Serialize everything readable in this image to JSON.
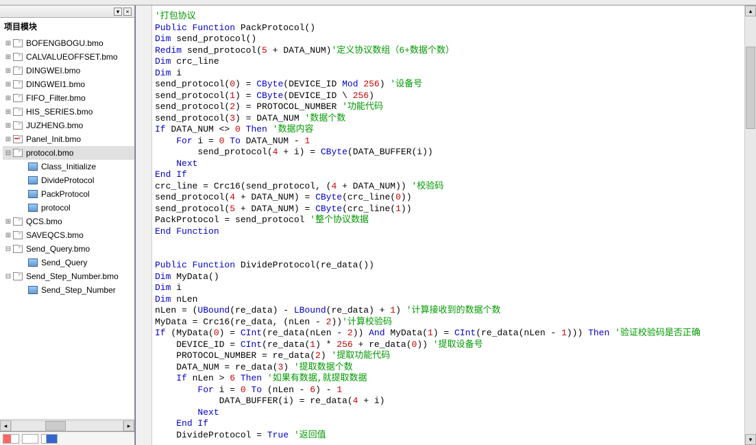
{
  "panel": {
    "title": "项目模块"
  },
  "tree": {
    "items": [
      {
        "icon": "doc",
        "label": "BOFENGBOGU.bmo",
        "exp": "⊞"
      },
      {
        "icon": "doc",
        "label": "CALVALUEOFFSET.bmo",
        "exp": "⊞"
      },
      {
        "icon": "doc",
        "label": "DINGWEI.bmo",
        "exp": "⊞"
      },
      {
        "icon": "doc",
        "label": "DINGWEI1.bmo",
        "exp": "⊞"
      },
      {
        "icon": "doc",
        "label": "FIFO_Filter.bmo",
        "exp": "⊞"
      },
      {
        "icon": "doc",
        "label": "HIS_SERIES.bmo",
        "exp": "⊞"
      },
      {
        "icon": "doc",
        "label": "JUZHENG.bmo",
        "exp": "⊞"
      },
      {
        "icon": "doc-red",
        "label": "Panel_Init.bmo",
        "exp": "⊞"
      },
      {
        "icon": "doc",
        "label": "protocol.bmo",
        "exp": "⊟",
        "selected": true
      },
      {
        "icon": "mod",
        "label": "Class_Initialize",
        "indent": 1,
        "exp": ""
      },
      {
        "icon": "mod",
        "label": "DivideProtocol",
        "indent": 1,
        "exp": ""
      },
      {
        "icon": "mod",
        "label": "PackProtocol",
        "indent": 1,
        "exp": ""
      },
      {
        "icon": "mod",
        "label": "protocol",
        "indent": 1,
        "exp": ""
      },
      {
        "icon": "doc",
        "label": "QCS.bmo",
        "exp": "⊞"
      },
      {
        "icon": "doc",
        "label": "SAVEQCS.bmo",
        "exp": "⊞"
      },
      {
        "icon": "doc",
        "label": "Send_Query.bmo",
        "exp": "⊟"
      },
      {
        "icon": "mod",
        "label": "Send_Query",
        "indent": 1,
        "exp": ""
      },
      {
        "icon": "doc",
        "label": "Send_Step_Number.bmo",
        "exp": "⊟"
      },
      {
        "icon": "mod",
        "label": "Send_Step_Number",
        "indent": 1,
        "exp": ""
      }
    ]
  },
  "code": {
    "lines": [
      [
        {
          "t": "'打包协议",
          "c": "cm"
        }
      ],
      [
        {
          "t": "Public Function",
          "c": "kw"
        },
        {
          "t": " PackProtocol()"
        }
      ],
      [
        {
          "t": "Dim",
          "c": "kw"
        },
        {
          "t": " send_protocol()"
        }
      ],
      [
        {
          "t": "Redim",
          "c": "kw"
        },
        {
          "t": " send_protocol("
        },
        {
          "t": "5",
          "c": "nm"
        },
        {
          "t": " + DATA_NUM)"
        },
        {
          "t": "'定义协议数组（6+数据个数）",
          "c": "cm"
        }
      ],
      [
        {
          "t": "Dim",
          "c": "kw"
        },
        {
          "t": " crc_line"
        }
      ],
      [
        {
          "t": "Dim",
          "c": "kw"
        },
        {
          "t": " i"
        }
      ],
      [
        {
          "t": "send_protocol("
        },
        {
          "t": "0",
          "c": "nm"
        },
        {
          "t": ") = "
        },
        {
          "t": "CByte",
          "c": "kw"
        },
        {
          "t": "(DEVICE_ID "
        },
        {
          "t": "Mod",
          "c": "kw"
        },
        {
          "t": " "
        },
        {
          "t": "256",
          "c": "nm"
        },
        {
          "t": ") "
        },
        {
          "t": "'设备号",
          "c": "cm"
        }
      ],
      [
        {
          "t": "send_protocol("
        },
        {
          "t": "1",
          "c": "nm"
        },
        {
          "t": ") = "
        },
        {
          "t": "CByte",
          "c": "kw"
        },
        {
          "t": "(DEVICE_ID \\ "
        },
        {
          "t": "256",
          "c": "nm"
        },
        {
          "t": ")"
        }
      ],
      [
        {
          "t": "send_protocol("
        },
        {
          "t": "2",
          "c": "nm"
        },
        {
          "t": ") = PROTOCOL_NUMBER "
        },
        {
          "t": "'功能代码",
          "c": "cm"
        }
      ],
      [
        {
          "t": "send_protocol("
        },
        {
          "t": "3",
          "c": "nm"
        },
        {
          "t": ") = DATA_NUM "
        },
        {
          "t": "'数据个数",
          "c": "cm"
        }
      ],
      [
        {
          "t": "If",
          "c": "kw"
        },
        {
          "t": " DATA_NUM <> "
        },
        {
          "t": "0",
          "c": "nm"
        },
        {
          "t": " "
        },
        {
          "t": "Then",
          "c": "kw"
        },
        {
          "t": " "
        },
        {
          "t": "'数据内容",
          "c": "cm"
        }
      ],
      [
        {
          "t": "    "
        },
        {
          "t": "For",
          "c": "kw"
        },
        {
          "t": " i = "
        },
        {
          "t": "0",
          "c": "nm"
        },
        {
          "t": " "
        },
        {
          "t": "To",
          "c": "kw"
        },
        {
          "t": " DATA_NUM - "
        },
        {
          "t": "1",
          "c": "nm"
        }
      ],
      [
        {
          "t": "        send_protocol("
        },
        {
          "t": "4",
          "c": "nm"
        },
        {
          "t": " + i) = "
        },
        {
          "t": "CByte",
          "c": "kw"
        },
        {
          "t": "(DATA_BUFFER(i))"
        }
      ],
      [
        {
          "t": "    "
        },
        {
          "t": "Next",
          "c": "kw"
        }
      ],
      [
        {
          "t": "End If",
          "c": "kw"
        }
      ],
      [
        {
          "t": "crc_line = Crc16(send_protocol, ("
        },
        {
          "t": "4",
          "c": "nm"
        },
        {
          "t": " + DATA_NUM)) "
        },
        {
          "t": "'校验码",
          "c": "cm"
        }
      ],
      [
        {
          "t": "send_protocol("
        },
        {
          "t": "4",
          "c": "nm"
        },
        {
          "t": " + DATA_NUM) = "
        },
        {
          "t": "CByte",
          "c": "kw"
        },
        {
          "t": "(crc_line("
        },
        {
          "t": "0",
          "c": "nm"
        },
        {
          "t": "))"
        }
      ],
      [
        {
          "t": "send_protocol("
        },
        {
          "t": "5",
          "c": "nm"
        },
        {
          "t": " + DATA_NUM) = "
        },
        {
          "t": "CByte",
          "c": "kw"
        },
        {
          "t": "(crc_line("
        },
        {
          "t": "1",
          "c": "nm"
        },
        {
          "t": "))"
        }
      ],
      [
        {
          "t": "PackProtocol = send_protocol "
        },
        {
          "t": "'整个协议数据",
          "c": "cm"
        }
      ],
      [
        {
          "t": "End Function",
          "c": "kw"
        }
      ],
      [
        {
          "t": ""
        }
      ],
      [
        {
          "t": ""
        }
      ],
      [
        {
          "t": "Public Function",
          "c": "kw"
        },
        {
          "t": " DivideProtocol(re_data())"
        }
      ],
      [
        {
          "t": "Dim",
          "c": "kw"
        },
        {
          "t": " MyData()"
        }
      ],
      [
        {
          "t": "Dim",
          "c": "kw"
        },
        {
          "t": " i"
        }
      ],
      [
        {
          "t": "Dim",
          "c": "kw"
        },
        {
          "t": " nLen"
        }
      ],
      [
        {
          "t": "nLen = ("
        },
        {
          "t": "UBound",
          "c": "kw"
        },
        {
          "t": "(re_data) - "
        },
        {
          "t": "LBound",
          "c": "kw"
        },
        {
          "t": "(re_data) + "
        },
        {
          "t": "1",
          "c": "nm"
        },
        {
          "t": ") "
        },
        {
          "t": "'计算接收到的数据个数",
          "c": "cm"
        }
      ],
      [
        {
          "t": "MyData = Crc16(re_data, (nLen - "
        },
        {
          "t": "2",
          "c": "nm"
        },
        {
          "t": "))"
        },
        {
          "t": "'计算校验码",
          "c": "cm"
        }
      ],
      [
        {
          "t": "If",
          "c": "kw"
        },
        {
          "t": " (MyData("
        },
        {
          "t": "0",
          "c": "nm"
        },
        {
          "t": ") = "
        },
        {
          "t": "CInt",
          "c": "kw"
        },
        {
          "t": "(re_data(nLen - "
        },
        {
          "t": "2",
          "c": "nm"
        },
        {
          "t": ")) "
        },
        {
          "t": "And",
          "c": "kw"
        },
        {
          "t": " MyData("
        },
        {
          "t": "1",
          "c": "nm"
        },
        {
          "t": ") = "
        },
        {
          "t": "CInt",
          "c": "kw"
        },
        {
          "t": "(re_data(nLen - "
        },
        {
          "t": "1",
          "c": "nm"
        },
        {
          "t": "))) "
        },
        {
          "t": "Then",
          "c": "kw"
        },
        {
          "t": " "
        },
        {
          "t": "'验证校验码是否正确",
          "c": "cm"
        }
      ],
      [
        {
          "t": "    DEVICE_ID = "
        },
        {
          "t": "CInt",
          "c": "kw"
        },
        {
          "t": "(re_data("
        },
        {
          "t": "1",
          "c": "nm"
        },
        {
          "t": ") * "
        },
        {
          "t": "256",
          "c": "nm"
        },
        {
          "t": " + re_data("
        },
        {
          "t": "0",
          "c": "nm"
        },
        {
          "t": ")) "
        },
        {
          "t": "'提取设备号",
          "c": "cm"
        }
      ],
      [
        {
          "t": "    PROTOCOL_NUMBER = re_data("
        },
        {
          "t": "2",
          "c": "nm"
        },
        {
          "t": ") "
        },
        {
          "t": "'提取功能代码",
          "c": "cm"
        }
      ],
      [
        {
          "t": "    DATA_NUM = re_data("
        },
        {
          "t": "3",
          "c": "nm"
        },
        {
          "t": ") "
        },
        {
          "t": "'提取数据个数",
          "c": "cm"
        }
      ],
      [
        {
          "t": "    "
        },
        {
          "t": "If",
          "c": "kw"
        },
        {
          "t": " nLen > "
        },
        {
          "t": "6",
          "c": "nm"
        },
        {
          "t": " "
        },
        {
          "t": "Then",
          "c": "kw"
        },
        {
          "t": " "
        },
        {
          "t": "'如果有数据,就提取数据",
          "c": "cm"
        }
      ],
      [
        {
          "t": "        "
        },
        {
          "t": "For",
          "c": "kw"
        },
        {
          "t": " i = "
        },
        {
          "t": "0",
          "c": "nm"
        },
        {
          "t": " "
        },
        {
          "t": "To",
          "c": "kw"
        },
        {
          "t": " (nLen - "
        },
        {
          "t": "6",
          "c": "nm"
        },
        {
          "t": ") - "
        },
        {
          "t": "1",
          "c": "nm"
        }
      ],
      [
        {
          "t": "            DATA_BUFFER(i) = re_data("
        },
        {
          "t": "4",
          "c": "nm"
        },
        {
          "t": " + i)"
        }
      ],
      [
        {
          "t": "        "
        },
        {
          "t": "Next",
          "c": "kw"
        }
      ],
      [
        {
          "t": "    "
        },
        {
          "t": "End If",
          "c": "kw"
        }
      ],
      [
        {
          "t": "    DivideProtocol = "
        },
        {
          "t": "True",
          "c": "kw"
        },
        {
          "t": " "
        },
        {
          "t": "'返回值",
          "c": "cm"
        }
      ]
    ]
  }
}
